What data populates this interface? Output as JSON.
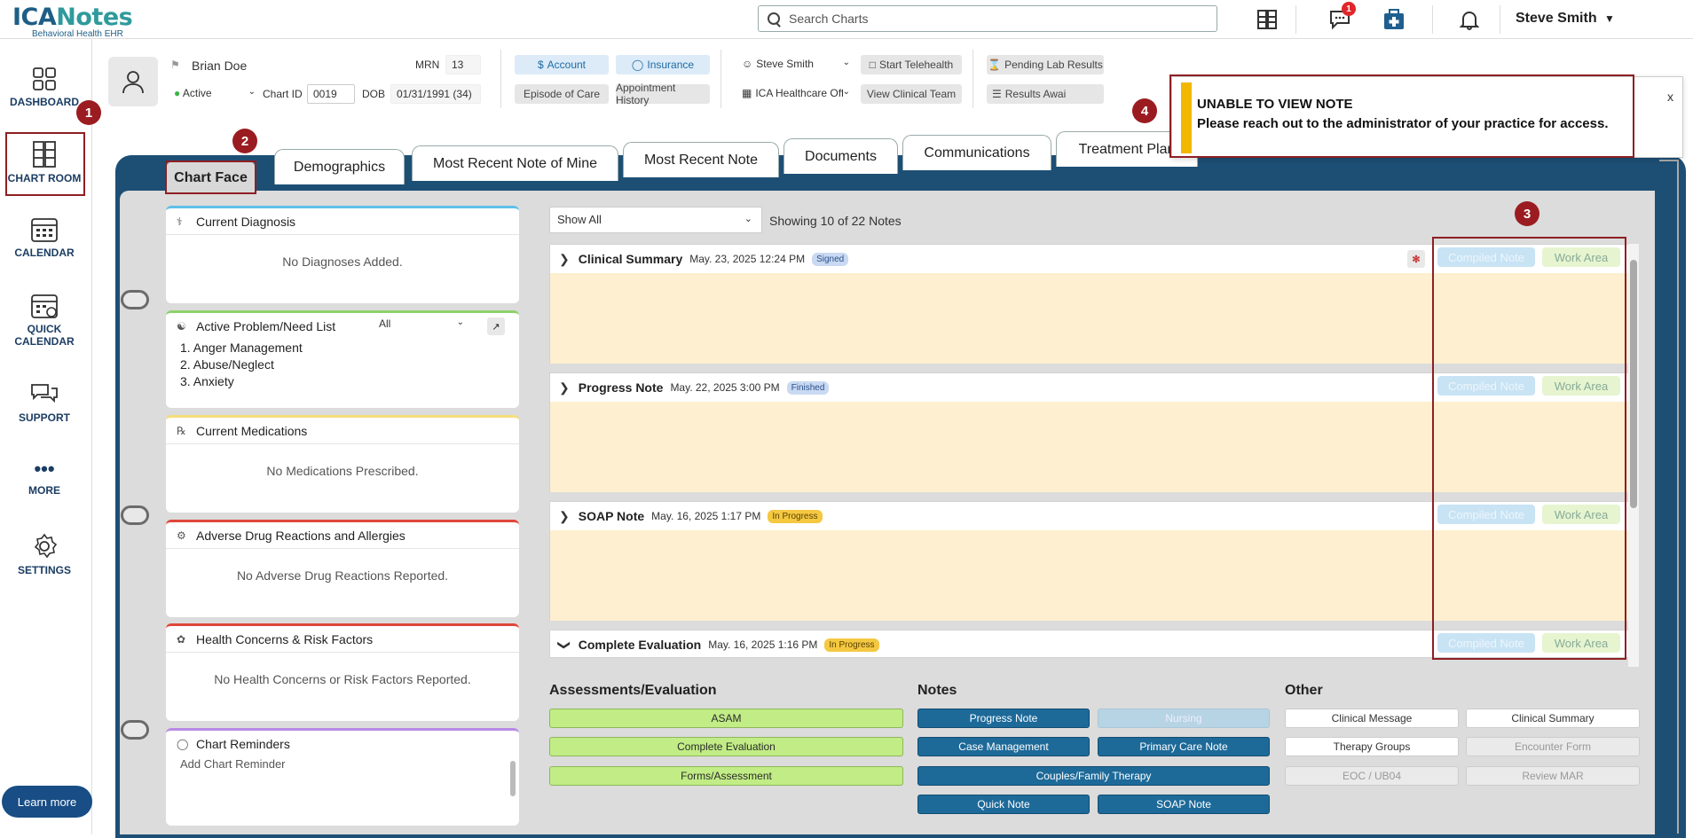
{
  "header": {
    "logo_main": "ICANotes",
    "logo_sub": "Behavioral Health EHR",
    "search_placeholder": "Search Charts",
    "messages_badge": "1",
    "user_name": "Steve Smith"
  },
  "sidebar": {
    "items": [
      {
        "label": "DASHBOARD"
      },
      {
        "label": "CHART ROOM"
      },
      {
        "label": "CALENDAR"
      },
      {
        "label": "QUICK CALENDAR"
      },
      {
        "label": "SUPPORT"
      },
      {
        "label": "MORE"
      },
      {
        "label": "SETTINGS"
      }
    ],
    "learn_more": "Learn more"
  },
  "callouts": [
    "1",
    "2",
    "3",
    "4"
  ],
  "patient": {
    "name": "Brian Doe",
    "mrn_label": "MRN",
    "mrn": "13",
    "status": "Active",
    "chart_id_label": "Chart ID",
    "chart_id": "0019",
    "dob_label": "DOB",
    "dob": "01/31/1991 (34)",
    "account": "Account",
    "insurance": "Insurance",
    "episode": "Episode of Care",
    "appointments": "Appointment History",
    "provider": "Steve Smith",
    "office": "ICA Healthcare Offi",
    "start_telehealth": "Start Telehealth",
    "view_team": "View Clinical Team",
    "pending_lab": "Pending Lab Results",
    "results_awaiting": "Results Awai"
  },
  "tabs": [
    "Chart Face",
    "Demographics",
    "Most Recent Note of Mine",
    "Most Recent Note",
    "Documents",
    "Communications",
    "Treatment Plan"
  ],
  "left_panels": {
    "diagnosis": {
      "title": "Current Diagnosis",
      "empty": "No Diagnoses Added.",
      "color": "#5ec0e8"
    },
    "problems": {
      "title": "Active Problem/Need List",
      "filter": "All",
      "items": [
        "1. Anger Management",
        "2. Abuse/Neglect",
        "3. Anxiety"
      ],
      "color": "#8fd16b"
    },
    "medications": {
      "title": "Current Medications",
      "icon": "℞",
      "empty": "No Medications Prescribed.",
      "color": "#f5dd79"
    },
    "allergies": {
      "title": "Adverse Drug Reactions and Allergies",
      "empty": "No Adverse Drug Reactions Reported.",
      "color": "#e0463a"
    },
    "health": {
      "title": "Health Concerns & Risk Factors",
      "empty": "No Health Concerns or Risk Factors Reported.",
      "color": "#e0463a"
    },
    "reminders": {
      "title": "Chart Reminders",
      "placeholder": "Add Chart Reminder",
      "color": "#b98ae6"
    }
  },
  "notes_filter": {
    "value": "Show All",
    "count": "Showing 10 of 22 Notes"
  },
  "notes": [
    {
      "type": "Clinical Summary",
      "date": "May. 23, 2025 12:24 PM",
      "status": "Signed",
      "status_bg": "#c9d9f2",
      "status_fg": "#2a4f8a"
    },
    {
      "type": "Progress Note",
      "date": "May. 22, 2025 3:00 PM",
      "status": "Finished",
      "status_bg": "#c9d9f2",
      "status_fg": "#2a4f8a"
    },
    {
      "type": "SOAP Note",
      "date": "May. 16, 2025 1:17 PM",
      "status": "In Progress",
      "status_bg": "#f5c842",
      "status_fg": "#5a4300"
    },
    {
      "type": "Complete Evaluation",
      "date": "May. 16, 2025 1:16 PM",
      "status": "In Progress",
      "status_bg": "#f5c842",
      "status_fg": "#5a4300"
    }
  ],
  "note_actions": {
    "compiled": "Compiled Note",
    "work": "Work Area"
  },
  "quick": {
    "assess_title": "Assessments/Evaluation",
    "assess": [
      "ASAM",
      "Complete Evaluation",
      "Forms/Assessment"
    ],
    "notes_title": "Notes",
    "notes": [
      "Progress Note",
      "Nursing",
      "Case Management",
      "Primary Care Note",
      "Couples/Family Therapy",
      "Quick Note",
      "SOAP Note"
    ],
    "other_title": "Other",
    "other": [
      "Clinical Message",
      "Clinical Summary",
      "Therapy Groups",
      "Encounter Form",
      "EOC / UB04",
      "Review MAR"
    ]
  },
  "alert": {
    "title": "UNABLE TO VIEW NOTE",
    "message": "Please reach out to the administrator of your practice for access.",
    "close": "x"
  }
}
